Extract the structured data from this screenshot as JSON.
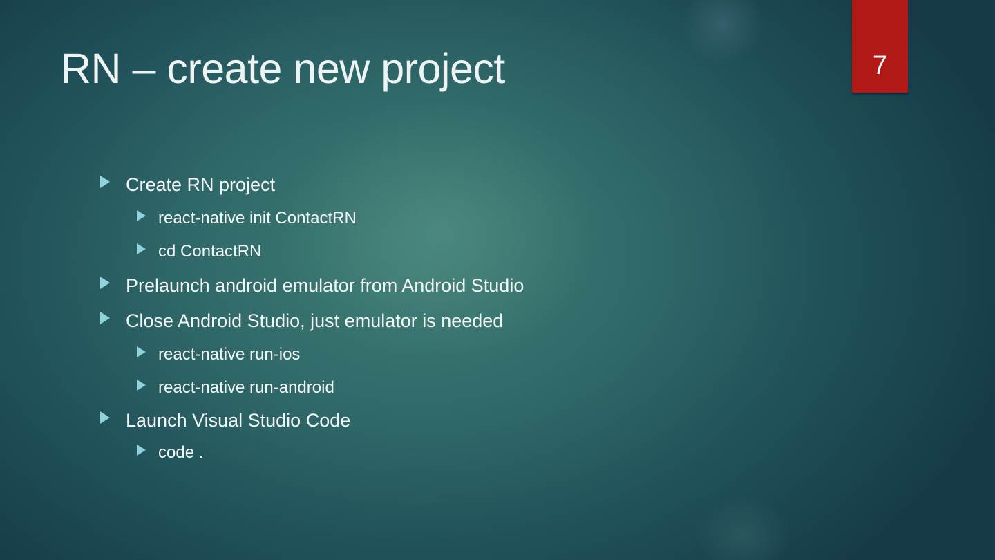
{
  "slide": {
    "title": "RN – create new project",
    "number": "7",
    "accent_color": "#b01916",
    "bullet_icon": "triangle-right-icon",
    "bullets": [
      {
        "level": 1,
        "text": "Create RN project"
      },
      {
        "level": 2,
        "text": "react-native init ContactRN"
      },
      {
        "level": 2,
        "text": "cd ContactRN"
      },
      {
        "level": 1,
        "text": "Prelaunch android emulator from Android Studio"
      },
      {
        "level": 1,
        "text": "Close Android Studio, just emulator is needed"
      },
      {
        "level": 2,
        "text": "react-native run-ios"
      },
      {
        "level": 2,
        "text": "react-native run-android"
      },
      {
        "level": 1,
        "text": "Launch Visual Studio Code"
      },
      {
        "level": 2,
        "text": "code ."
      }
    ]
  }
}
